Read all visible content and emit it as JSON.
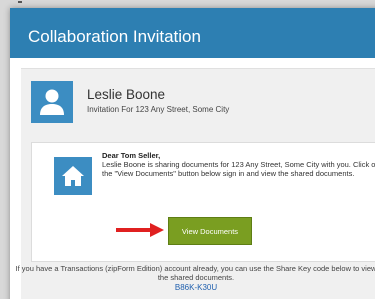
{
  "dialog": {
    "title": "Collaboration Invitation"
  },
  "sender": {
    "name": "Leslie Boone",
    "subtitle": "Invitation For 123 Any Street, Some City",
    "avatar_icon": "user-icon"
  },
  "message": {
    "greeting": "Dear Tom Seller,",
    "body": "Leslie Boone is sharing documents for 123 Any Street, Some City with you. Click on the \"View Documents\" button below sign in and view the shared documents.",
    "icon": "home-icon"
  },
  "actions": {
    "view_documents_label": "View Documents"
  },
  "footer": {
    "instructions": "If you have a Transactions (zipForm Edition) account already, you can use the Share Key code below to view the shared documents.",
    "share_key": "B86K-K30U"
  },
  "colors": {
    "header": "#2d7fb2",
    "icon_box": "#3c8dc2",
    "button": "#7a9e21",
    "arrow": "#e02020",
    "link": "#1f5fae"
  }
}
